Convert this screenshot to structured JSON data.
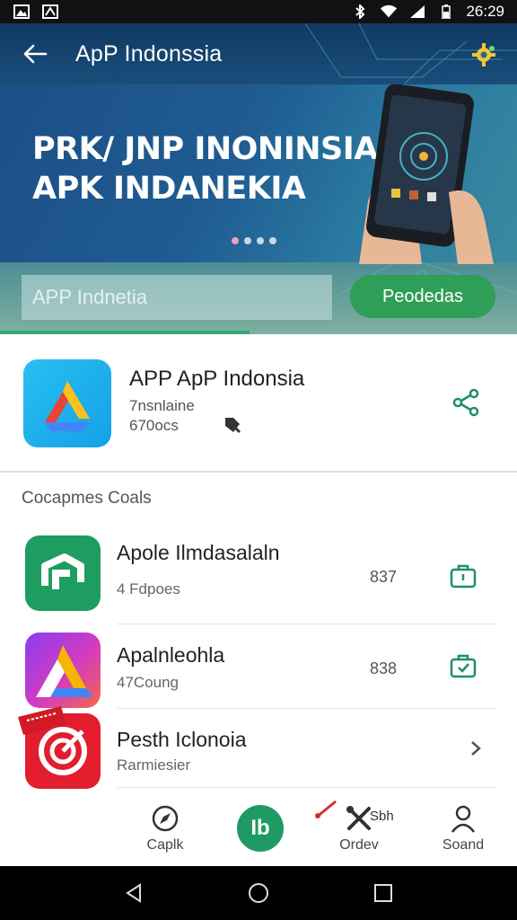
{
  "status_bar": {
    "time": "26:29",
    "left_icons": [
      "gallery-icon",
      "image-icon"
    ],
    "right_icons": [
      "bluetooth-icon",
      "wifi-icon",
      "signal-icon",
      "battery-icon"
    ]
  },
  "app_bar": {
    "title": "ApP Indonssia",
    "back_icon": "arrow-left-icon",
    "action_icon": "settings-gear-icon"
  },
  "banner": {
    "line1": "PRK/ JNP INONINSIA",
    "line2": "APK INDANEKIA",
    "dots_count": 4,
    "active_dot": 0
  },
  "search": {
    "placeholder": "APP Indnetia",
    "button_label": "Peodedas"
  },
  "featured": {
    "title": "APP ApP Indonsia",
    "subtitle": "7nsnlaine",
    "count": "670ocs",
    "share_icon": "share-icon"
  },
  "section": {
    "title": "Cocapmes Coals"
  },
  "list": [
    {
      "title": "Apole Ilmdasalaln",
      "subtitle": "4 Fdpoes",
      "value": "837",
      "action_icon": "briefcase-icon"
    },
    {
      "title": "Apalnleohla",
      "subtitle": "47Coung",
      "value": "838",
      "action_icon": "briefcase-check-icon"
    },
    {
      "title": "Pesth Iclonoia",
      "subtitle": "Rarmiesier",
      "value": "",
      "action_icon": "chevron-right-icon",
      "badge": "offer"
    }
  ],
  "bottom_nav": {
    "items": [
      {
        "label": "Caplk",
        "icon": "compass-icon"
      },
      {
        "label": "",
        "icon": "home-center-icon",
        "center_text": "Ib"
      },
      {
        "label": "Ordev",
        "icon": "tools-icon",
        "extra": "Sbh"
      },
      {
        "label": "Soand",
        "icon": "user-icon"
      }
    ]
  },
  "colors": {
    "accent_green": "#2f9e57",
    "header_blue": "#1b4f86",
    "teal": "#2ea87a"
  }
}
